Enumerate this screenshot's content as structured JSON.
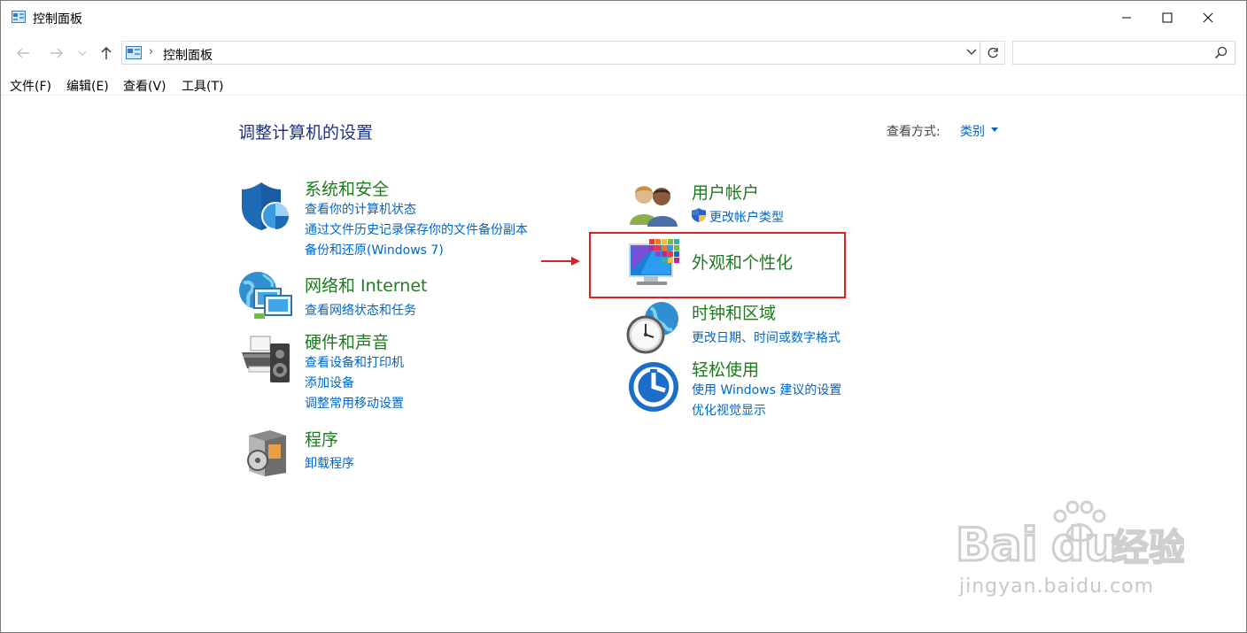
{
  "window": {
    "title": "控制面板"
  },
  "address": {
    "location": "控制面板",
    "search_placeholder": ""
  },
  "menu": [
    {
      "label": "文件(F)"
    },
    {
      "label": "编辑(E)"
    },
    {
      "label": "查看(V)"
    },
    {
      "label": "工具(T)"
    }
  ],
  "main": {
    "title": "调整计算机的设置",
    "view_by_label": "查看方式:",
    "view_by_value": "类别"
  },
  "categories": {
    "system_security": {
      "title": "系统和安全",
      "links": [
        "查看你的计算机状态",
        "通过文件历史记录保存你的文件备份副本",
        "备份和还原(Windows 7)"
      ]
    },
    "network": {
      "title": "网络和 Internet",
      "links": [
        "查看网络状态和任务"
      ]
    },
    "hardware": {
      "title": "硬件和声音",
      "links": [
        "查看设备和打印机",
        "添加设备",
        "调整常用移动设置"
      ]
    },
    "programs": {
      "title": "程序",
      "links": [
        "卸载程序"
      ]
    },
    "user_accounts": {
      "title": "用户帐户",
      "links": [
        "更改帐户类型"
      ]
    },
    "appearance": {
      "title": "外观和个性化"
    },
    "clock_region": {
      "title": "时钟和区域",
      "links": [
        "更改日期、时间或数字格式"
      ]
    },
    "ease_access": {
      "title": "轻松使用",
      "links": [
        "使用 Windows 建议的设置",
        "优化视觉显示"
      ]
    }
  },
  "watermark": {
    "brand": "Bai du 经验",
    "url": "jingyan.baidu.com"
  },
  "colors": {
    "link": "#0066cc",
    "category_title": "#1e7a1e",
    "page_title": "#1e3287",
    "highlight_box": "#e02020"
  }
}
